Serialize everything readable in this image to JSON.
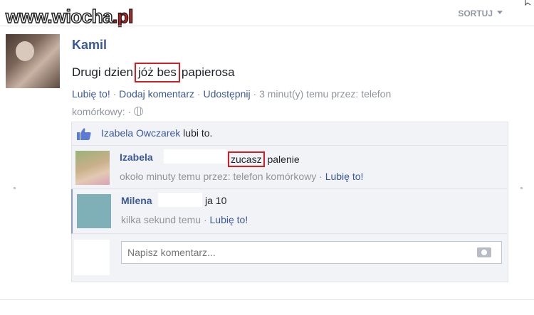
{
  "watermark": {
    "text": "www.wiocha",
    "accent": ".pl"
  },
  "header": {
    "sort_label": "SORTUJ"
  },
  "post": {
    "author": "Kamil",
    "text_before": "Drugi dzien",
    "boxed_text": "jóż bes",
    "text_after": "papierosa",
    "actions": {
      "like": "Lubię to!",
      "comment": "Dodaj komentarz",
      "share": "Udostępnij",
      "meta_line1": "3 minut(y) temu przez: telefon",
      "meta_line2": "komórkowy:"
    }
  },
  "likes": {
    "name": "Izabela Owczarek",
    "suffix": "lubi to."
  },
  "comments": [
    {
      "name": "Izabela",
      "before": "",
      "boxed": "zucasz",
      "after": "palenie",
      "meta": "około minuty temu przez: telefon komórkowy",
      "like": "Lubię to!"
    },
    {
      "name": "Milena",
      "text": "ja 10",
      "meta": "kilka sekund temu",
      "like": "Lubię to!"
    }
  ],
  "reply": {
    "placeholder": "Napisz komentarz..."
  },
  "colors": {
    "link": "#3b5998",
    "highlight": "#d21f25",
    "meta": "#90949c"
  }
}
